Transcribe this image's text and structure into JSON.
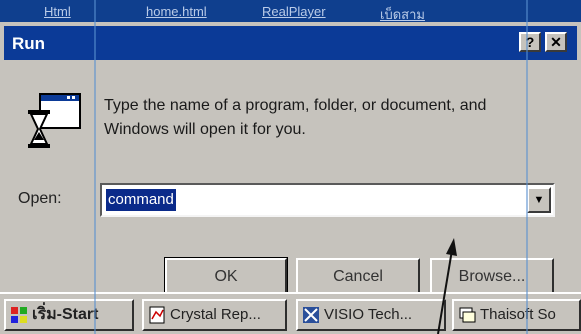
{
  "desktop": {
    "icons": [
      "Html",
      "home.html",
      "RealPlayer",
      "เบ็ดสาม"
    ]
  },
  "dialog": {
    "title": "Run",
    "help_glyph": "?",
    "close_glyph": "✕",
    "icon": "program-hourglass-icon",
    "message_line1": "Type the name of a program, folder, or document, and",
    "message_line2": "Windows will open it for you.",
    "open_label": "Open:",
    "open_value": "command",
    "dropdown_glyph": "▼",
    "ok_label": "OK",
    "cancel_label": "Cancel",
    "browse_label": "Browse..."
  },
  "taskbar": {
    "start_label": "เริ่ม-Start",
    "items": [
      {
        "label": "Crystal Rep...",
        "icon": "crystal-reports-icon"
      },
      {
        "label": "VISIO Tech...",
        "icon": "visio-icon"
      },
      {
        "label": "Thaisoft So",
        "icon": "thaisoft-icon"
      }
    ]
  },
  "colors": {
    "titlebar": "#0b3a97",
    "face": "#c6c3bd",
    "selection": "#0a2a8a",
    "desktop": "#0f3f8e"
  }
}
